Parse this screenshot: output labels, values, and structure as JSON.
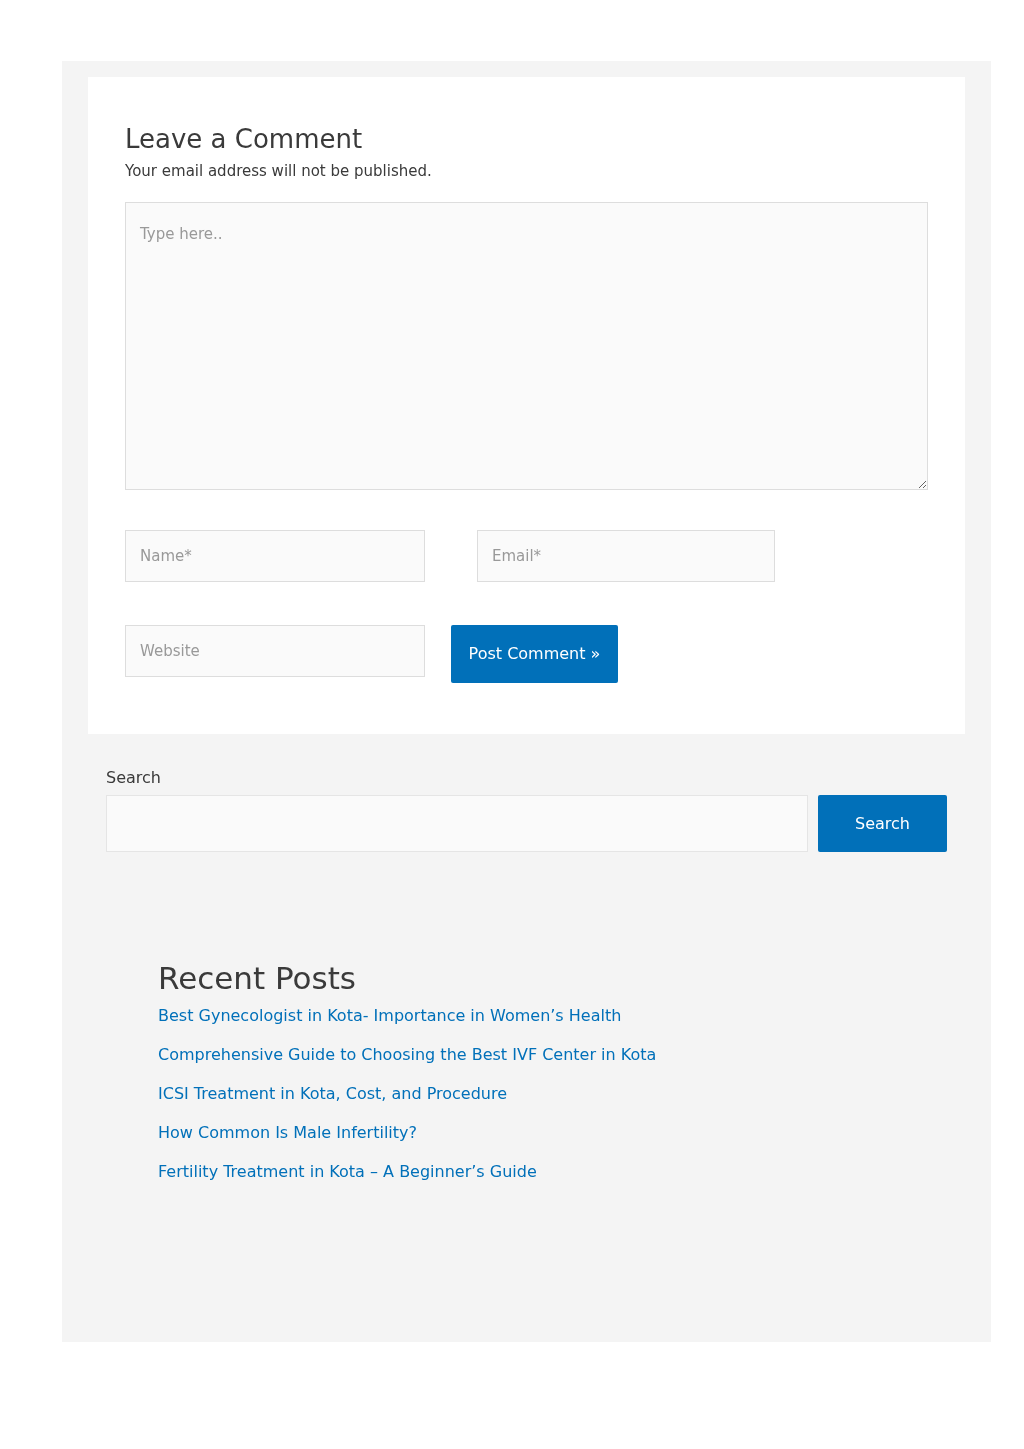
{
  "comment_form": {
    "title": "Leave a Comment",
    "note": "Your email address will not be published.",
    "comment_placeholder": "Type here..",
    "name_placeholder": "Name*",
    "email_placeholder": "Email*",
    "website_placeholder": "Website",
    "submit": "Post Comment »"
  },
  "search": {
    "label": "Search",
    "button": "Search"
  },
  "recent_posts": {
    "title": "Recent Posts",
    "items": [
      {
        "label": "Best Gynecologist in Kota- Importance in Women’s Health"
      },
      {
        "label": "Comprehensive Guide to Choosing the Best IVF Center in Kota"
      },
      {
        "label": "ICSI Treatment in Kota, Cost, and Procedure"
      },
      {
        "label": "How Common Is Male Infertility?"
      },
      {
        "label": "Fertility Treatment in Kota – A Beginner’s Guide"
      }
    ]
  }
}
